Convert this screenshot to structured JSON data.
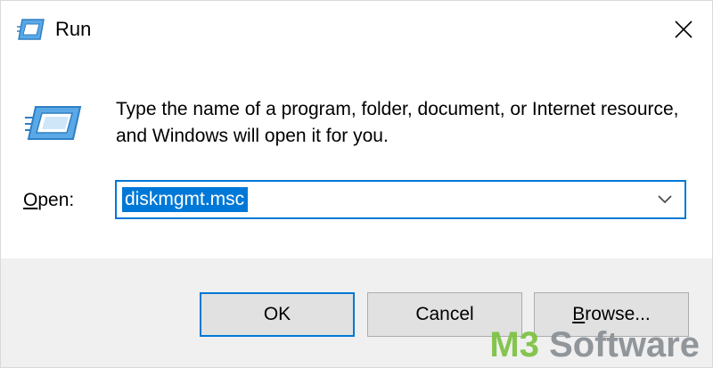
{
  "window": {
    "title": "Run",
    "title_icon": "run-icon",
    "close_icon": "close-icon"
  },
  "dialog": {
    "prompt": "Type the name of a program, folder, document, or Internet resource, and Windows will open it for you.",
    "open_label_accel": "O",
    "open_label_rest": "pen:",
    "open_value": "diskmgmt.msc",
    "dropdown_icon": "chevron-down-icon"
  },
  "buttons": {
    "ok": "OK",
    "cancel": "Cancel",
    "browse_accel": "B",
    "browse_rest": "rowse..."
  },
  "watermark": {
    "brand_prefix": "M3",
    "brand_suffix": " Software"
  },
  "colors": {
    "accent": "#0078d7",
    "footer_bg": "#f0f0f0",
    "button_bg": "#e1e1e1",
    "watermark_green": "#7cc242",
    "watermark_gray": "#8a8f94"
  }
}
